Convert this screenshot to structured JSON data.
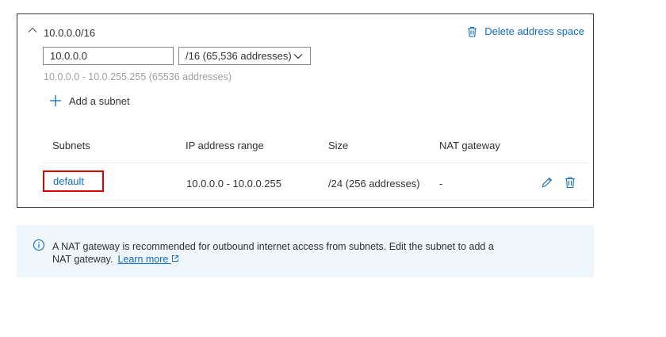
{
  "address_space": {
    "title": "10.0.0.0/16",
    "delete_label": "Delete address space",
    "address_value": "10.0.0.0",
    "prefix_selected": "/16 (65,536 addresses)",
    "range_hint": "10.0.0.0 - 10.0.255.255 (65536 addresses)"
  },
  "add_subnet_label": "Add a subnet",
  "table": {
    "headers": [
      "Subnets",
      "IP address range",
      "Size",
      "NAT gateway"
    ],
    "rows": [
      {
        "name": "default",
        "range": "10.0.0.0 - 10.0.0.255",
        "size": "/24 (256 addresses)",
        "nat": "-"
      }
    ]
  },
  "info": {
    "message": "A NAT gateway is recommended for outbound internet access from subnets. Edit the subnet to add a NAT gateway.",
    "link_label": "Learn more"
  },
  "colors": {
    "link": "#0f6cbd",
    "highlight": "#e00000",
    "info_background": "#eff6fc"
  }
}
